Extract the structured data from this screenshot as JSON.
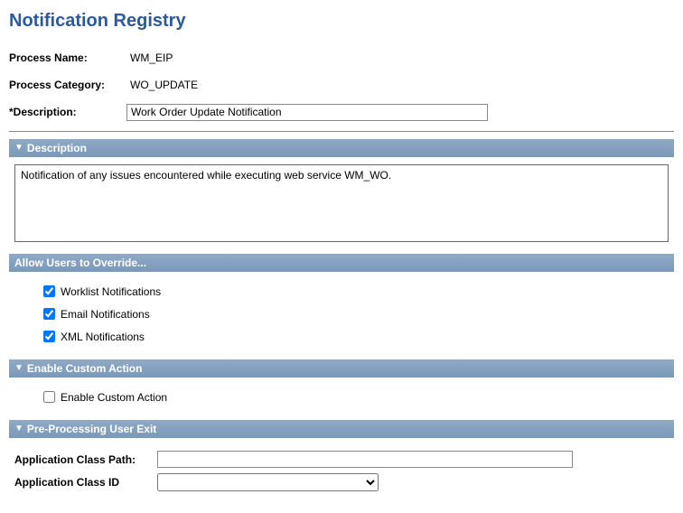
{
  "page": {
    "title": "Notification Registry"
  },
  "header": {
    "process_name_label": "Process Name:",
    "process_name_value": "WM_EIP",
    "process_category_label": "Process Category:",
    "process_category_value": "WO_UPDATE",
    "description_label": "*Description:",
    "description_value": "Work Order Update Notification"
  },
  "description_section": {
    "title": "Description",
    "text": "Notification of any issues encountered while executing web service WM_WO."
  },
  "override_section": {
    "title": "Allow Users to Override...",
    "worklist_label": "Worklist Notifications",
    "worklist_checked": true,
    "email_label": "Email Notifications",
    "email_checked": true,
    "xml_label": "XML Notifications",
    "xml_checked": true
  },
  "custom_action_section": {
    "title": "Enable Custom Action",
    "enable_label": "Enable Custom Action",
    "enable_checked": false
  },
  "preproc_section": {
    "title": "Pre-Processing User Exit",
    "app_class_path_label": "Application Class Path:",
    "app_class_path_value": "",
    "app_class_id_label": "Application Class ID",
    "app_class_id_value": ""
  }
}
